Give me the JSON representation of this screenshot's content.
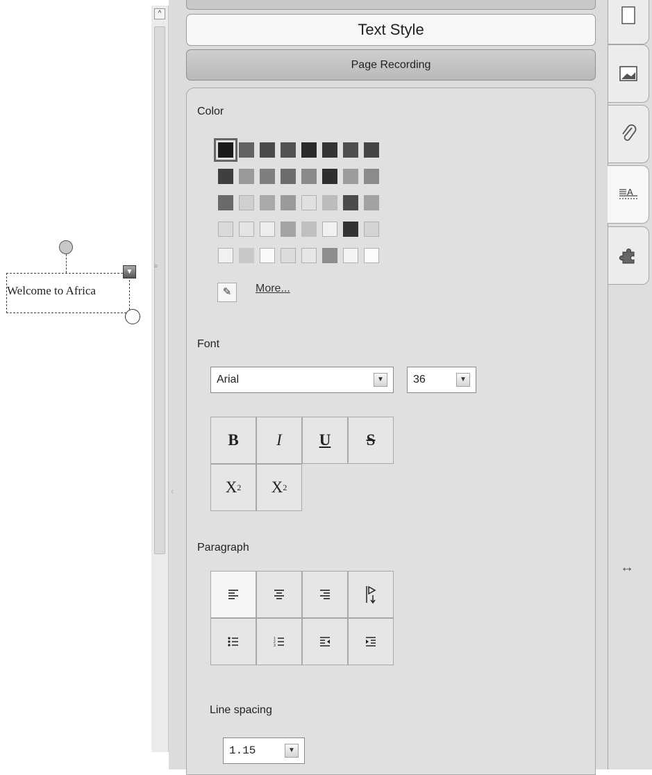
{
  "canvas": {
    "text_object_label": "Welcome to Africa"
  },
  "panel": {
    "header_tab_active": "Text Style",
    "header_tab_next": "Page Recording",
    "color": {
      "label": "Color",
      "more_label": "More...",
      "selected_index": 0,
      "swatches": [
        [
          "#1b1b1b",
          "#626262",
          "#4a4a4a",
          "#525252",
          "#2a2a2a",
          "#353535",
          "#4e4e4e",
          "#444444"
        ],
        [
          "#3f3f3f",
          "#9a9a9a",
          "#7f7f7f",
          "#6d6d6d",
          "#8a8a8a",
          "#2f2f2f",
          "#9c9c9c",
          "#8b8b8b"
        ],
        [
          "#6a6a6a",
          "#cfcfcf",
          "#a9a9a9",
          "#9a9a9a",
          "#e0e0e0",
          "#bcbcbc",
          "#4b4b4b",
          "#a2a2a2"
        ],
        [
          "#dadada",
          "#e4e4e4",
          "#ededed",
          "#a4a4a4",
          "#bfbfbf",
          "#f1f1f1",
          "#333333",
          "#d3d3d3"
        ],
        [
          "#f1f1f1",
          "#c8c8c8",
          "#fafafa",
          "#dcdcdc",
          "#e6e6e6",
          "#8d8d8d",
          "#f3f3f3",
          "#fbfbfb"
        ]
      ]
    },
    "font": {
      "label": "Font",
      "family": "Arial",
      "size": "36",
      "buttons": {
        "bold": "B",
        "italic": "I",
        "underline": "U",
        "strike": "S",
        "subscript_base": "X",
        "subscript_mark": "2",
        "superscript_base": "X",
        "superscript_mark": "2"
      }
    },
    "paragraph": {
      "label": "Paragraph",
      "active_alignment": "left"
    },
    "line_spacing": {
      "label": "Line spacing",
      "value": "1.15"
    }
  },
  "side_tabs": [
    "page-icon",
    "gallery-icon",
    "attachment-icon",
    "properties-icon",
    "addon-icon"
  ],
  "active_side_tab": "properties-icon"
}
